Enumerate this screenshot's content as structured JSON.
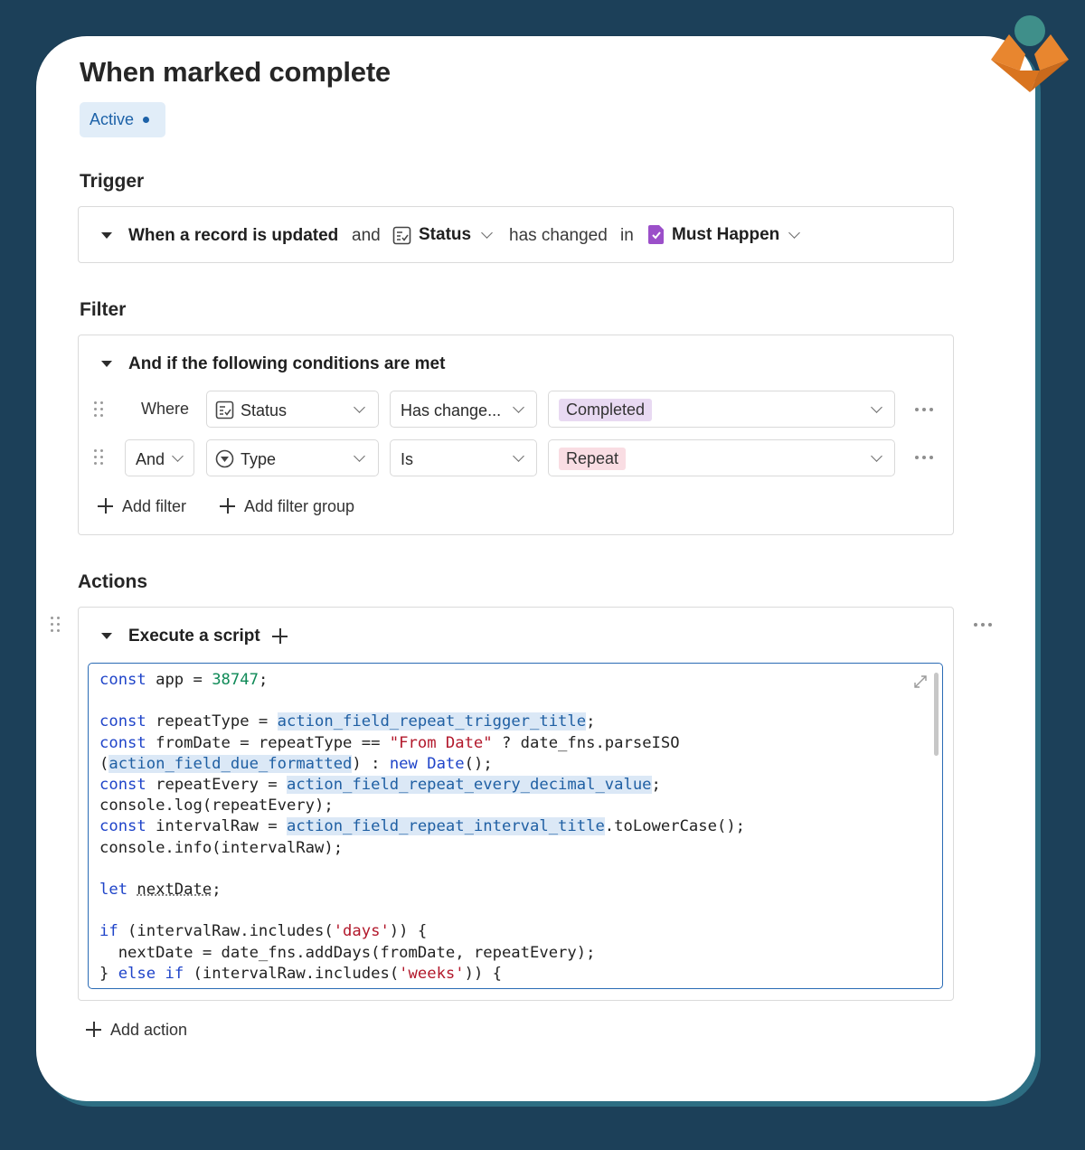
{
  "automation": {
    "title": "When marked complete",
    "status": "Active"
  },
  "trigger": {
    "heading": "Trigger",
    "event": "When a record is updated",
    "and_word": "and",
    "field": "Status",
    "condition": "has changed",
    "in_word": "in",
    "table": "Must Happen"
  },
  "filter": {
    "heading": "Filter",
    "group_title": "And if the following conditions are met",
    "rows": [
      {
        "connector": "Where",
        "field": "Status",
        "operator": "Has change...",
        "value": "Completed"
      },
      {
        "connector": "And",
        "field": "Type",
        "operator": "Is",
        "value": "Repeat"
      }
    ],
    "add_filter": "Add filter",
    "add_filter_group": "Add filter group"
  },
  "actions": {
    "heading": "Actions",
    "action_title": "Execute a script",
    "add_action": "Add action",
    "script": {
      "lines": [
        "const app = 38747;",
        "",
        "const repeatType = action_field_repeat_trigger_title;",
        "const fromDate = repeatType == \"From Date\" ? date_fns.parseISO",
        "(action_field_due_formatted) : new Date();",
        "const repeatEvery = action_field_repeat_every_decimal_value;",
        "console.log(repeatEvery);",
        "const intervalRaw = action_field_repeat_interval_title.toLowerCase();",
        "console.info(intervalRaw);",
        "",
        "let nextDate;",
        "",
        "if (intervalRaw.includes('days')) {",
        "  nextDate = date_fns.addDays(fromDate, repeatEvery);",
        "} else if (intervalRaw.includes('weeks')) {"
      ]
    }
  },
  "colors": {
    "background": "#1c4059",
    "accent": "#1d62a8",
    "status_pill": "#e8d9f2",
    "repeat_pill": "#f9dde3",
    "table_icon": "#9b4fc9",
    "logo_orange": "#e8862f",
    "logo_teal": "#3f8f8a"
  },
  "icons": [
    "logo-icon",
    "caret-down-icon",
    "checkbox-field-icon",
    "chevron-down-icon",
    "table-icon",
    "drag-handle-icon",
    "single-select-icon",
    "more-icon",
    "plus-icon",
    "expand-icon"
  ]
}
